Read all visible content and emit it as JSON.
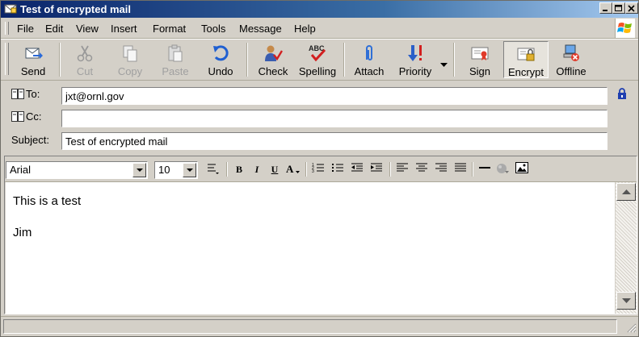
{
  "window": {
    "title": "Test of encrypted mail"
  },
  "menu": [
    "File",
    "Edit",
    "View",
    "Insert",
    "Format",
    "Tools",
    "Message",
    "Help"
  ],
  "toolbar": {
    "send": "Send",
    "cut": "Cut",
    "copy": "Copy",
    "paste": "Paste",
    "undo": "Undo",
    "check": "Check",
    "spelling": "Spelling",
    "attach": "Attach",
    "priority": "Priority",
    "sign": "Sign",
    "encrypt": "Encrypt",
    "offline": "Offline"
  },
  "header": {
    "to_label": "To:",
    "to_value": "jxt@ornl.gov",
    "cc_label": "Cc:",
    "cc_value": "",
    "subject_label": "Subject:",
    "subject_value": "Test of encrypted mail"
  },
  "format": {
    "font": "Arial",
    "size": "10"
  },
  "body": {
    "line1": "This is a test",
    "line2": "Jim"
  },
  "colors": {
    "titlebar_start": "#0a246a",
    "titlebar_end": "#a6caf0",
    "chrome": "#d4d0c8"
  }
}
